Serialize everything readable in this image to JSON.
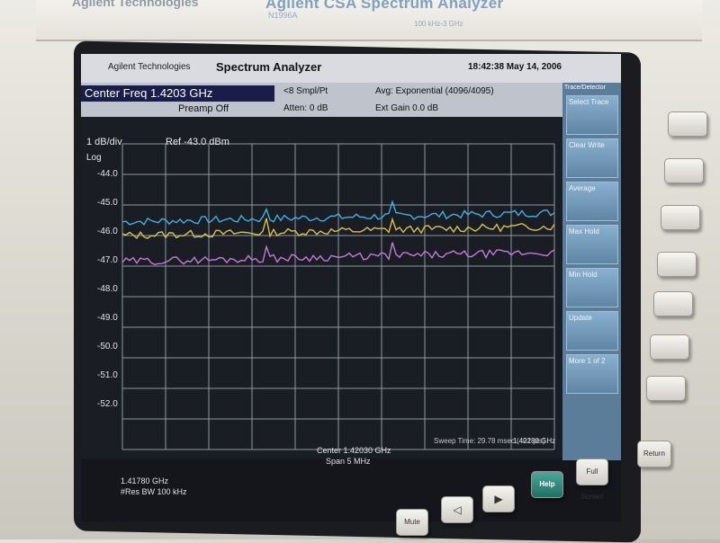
{
  "instrument": {
    "brand": "Agilent Technologies",
    "model_title": "Agilent CSA Spectrum Analyzer",
    "model_number": "N1996A",
    "frequency_range": "100 kHz-3 GHz"
  },
  "screen": {
    "header": {
      "brand": "Agilent Technologies",
      "title": "Spectrum Analyzer",
      "timestamp": "18:42:38 May 14, 2006"
    },
    "params": {
      "center_freq": "Center Freq 1.4203 GHz",
      "preamp": "Preamp Off",
      "sampling": "<8 Smpl/Pt",
      "attenuation": "Atten: 0 dB",
      "averaging": "Avg: Exponential (4096/4095)",
      "ext_gain": "Ext Gain 0.0 dB"
    },
    "plot": {
      "scale": "1 dB/div",
      "reference": "Ref -43.0 dBm",
      "log": "Log",
      "y_ticks": [
        "-44.0",
        "-45.0",
        "-46.0",
        "-47.0",
        "-48.0",
        "-49.0",
        "-50.0",
        "-51.0",
        "-52.0"
      ],
      "start_freq": "1.41780 GHz",
      "res_bw": "#Res BW 100 kHz",
      "center": "Center 1.42030 GHz",
      "span": "Span 5 MHz",
      "stop_freq": "1.42280 GHz",
      "sweep": "Sweep Time: 29.78 msec (401 pts)"
    },
    "softkeys": {
      "title": "Trace/Detector",
      "items": [
        "Select Trace",
        "Clear Write",
        "Average",
        "Max Hold",
        "Min Hold",
        "Update",
        "More 1 of 2"
      ]
    }
  },
  "front_panel": {
    "bottom_keys": [
      "Mute",
      "",
      "",
      "Help",
      "Full Screen"
    ],
    "return_key": "Return"
  },
  "colors": {
    "trace_cyan": "#3fb2e0",
    "trace_yellow": "#d9c24a",
    "trace_magenta": "#c47ad8"
  }
}
